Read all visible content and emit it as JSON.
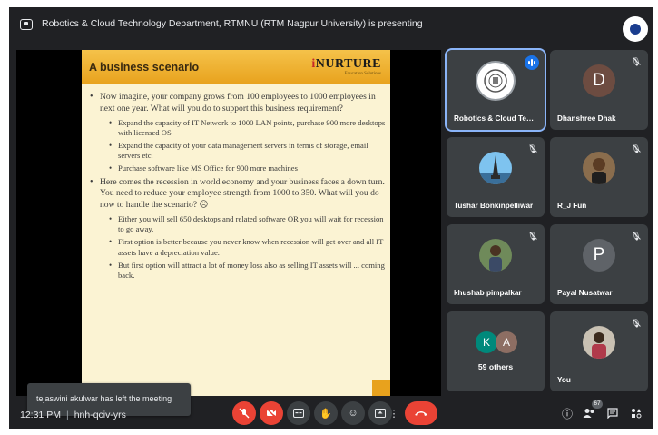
{
  "header": {
    "presenting_text": "Robotics & Cloud Technology Department, RTMNU (RTM Nagpur University) is presenting"
  },
  "slide": {
    "title": "A business scenario",
    "logo": "NURTURE",
    "logo_first": "i",
    "logo_sub": "Education Solutions",
    "bullets": [
      {
        "text": "Now imagine, your company grows from 100 employees to 1000 employees in next one year. What will you do to support this business requirement?",
        "sub": [
          "Expand the capacity of IT Network to 1000 LAN points, purchase 900 more desktops with licensed OS",
          "Expand the capacity of your data management servers in terms of storage, email servers etc.",
          "Purchase software like MS Office for 900 more machines"
        ]
      },
      {
        "text": "Here comes the recession in world economy and your business faces a down turn. You need to reduce your employee strength from 1000 to 350. What will you do now to handle the scenario? ☹",
        "sub": [
          "Either you will sell 650 desktops and related software OR you will wait for recession to go away.",
          "First option is better because you never know when recession will get over and all IT assets have a depreciation value.",
          "But first option will attract a lot of money loss also as selling IT assets will ... coming back."
        ]
      }
    ]
  },
  "toast": {
    "text": "tejaswini akulwar has left the meeting"
  },
  "participants": [
    {
      "name": "Robotics & Cloud Techn...",
      "type": "logo",
      "status": "talking"
    },
    {
      "name": "Dhanshree Dhak",
      "type": "letter",
      "letter": "D",
      "color": "#6d4c41",
      "status": "muted"
    },
    {
      "name": "Tushar Bonkinpelliwar",
      "type": "photo",
      "status": "muted"
    },
    {
      "name": "R_J Fun",
      "type": "photo",
      "status": "muted"
    },
    {
      "name": "khushab pimpalkar",
      "type": "photo",
      "status": "muted"
    },
    {
      "name": "Payal Nusatwar",
      "type": "letter",
      "letter": "P",
      "color": "#5f6368",
      "status": "muted"
    },
    {
      "name": "59 others",
      "type": "others",
      "letters": [
        "K",
        "A"
      ],
      "colors": [
        "#00897b",
        "#8d6e63"
      ]
    },
    {
      "name": "You",
      "type": "photo",
      "status": "muted"
    }
  ],
  "bottom": {
    "time": "12:31 PM",
    "meeting_code": "hnh-qciv-yrs",
    "people_count": "67"
  },
  "icons": {
    "mic_off": "mic-off-icon",
    "cam_off": "camera-off-icon",
    "captions": "captions-icon",
    "raise_hand": "raise-hand-icon",
    "emoji": "emoji-icon",
    "present": "present-icon",
    "more": "more-options-icon",
    "end_call": "end-call-icon",
    "info": "info-icon",
    "people": "people-icon",
    "chat": "chat-icon",
    "activities": "activities-icon"
  },
  "colors": {
    "accent": "#8ab4f8",
    "danger": "#ea4335",
    "background": "#202124",
    "tile": "#3c4043"
  }
}
